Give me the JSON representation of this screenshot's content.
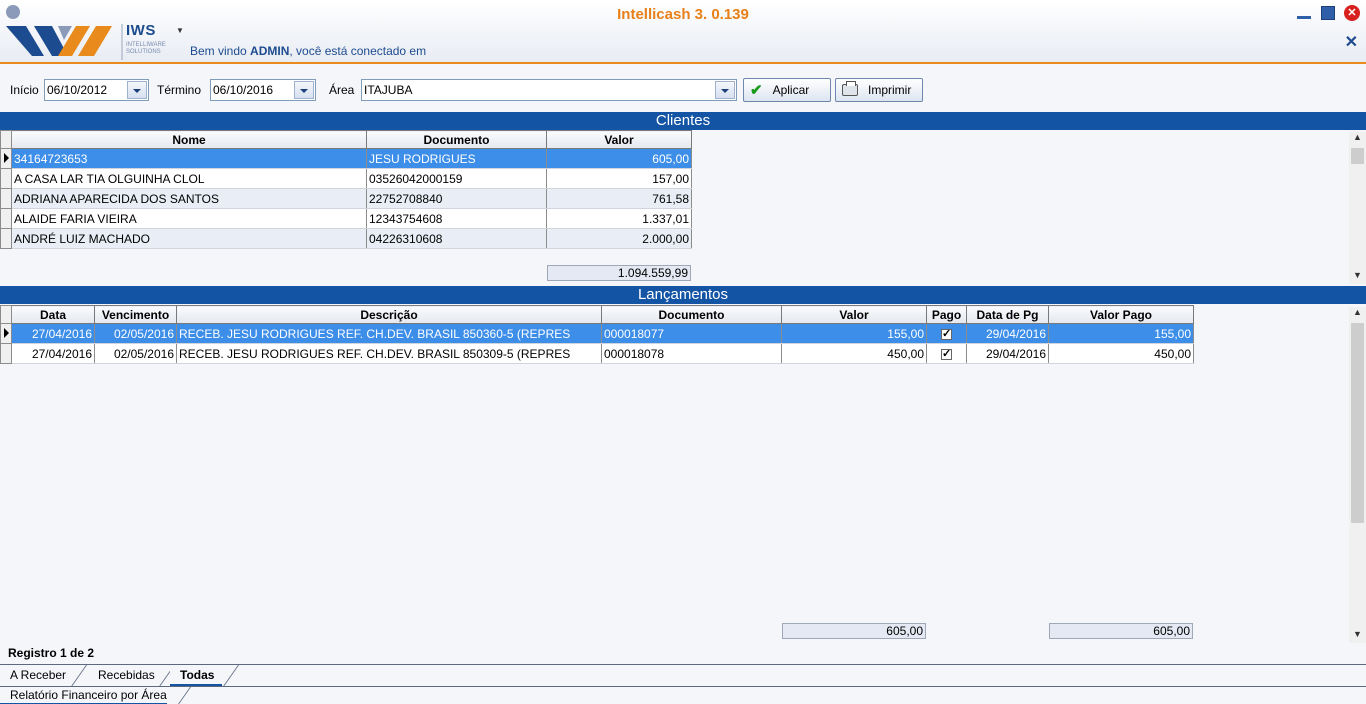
{
  "header": {
    "app_title": "Intellicash 3. 0.139",
    "logo_text": "IWS",
    "logo_subtext": "INTELLIWARE SOLUTIONS",
    "welcome_prefix": "Bem vindo ",
    "welcome_user": "ADMIN",
    "welcome_suffix": ", você está conectado em"
  },
  "filters": {
    "inicio_label": "Início",
    "inicio_value": "06/10/2012",
    "termino_label": "Término",
    "termino_value": "06/10/2016",
    "area_label": "Área",
    "area_value": "ITAJUBA",
    "aplicar_label": "Aplicar",
    "imprimir_label": "Imprimir"
  },
  "clientes": {
    "title": "Clientes",
    "columns": [
      "Nome",
      "Documento",
      "Valor"
    ],
    "rows": [
      {
        "nome": "34164723653",
        "documento": "JESU RODRIGUES",
        "valor": "605,00"
      },
      {
        "nome": "A CASA LAR TIA OLGUINHA CLOL",
        "documento": "03526042000159",
        "valor": "157,00"
      },
      {
        "nome": "ADRIANA APARECIDA DOS SANTOS",
        "documento": "22752708840",
        "valor": "761,58"
      },
      {
        "nome": "ALAIDE FARIA VIEIRA",
        "documento": "12343754608",
        "valor": "1.337,01"
      },
      {
        "nome": "ANDRÉ LUIZ MACHADO",
        "documento": "04226310608",
        "valor": "2.000,00"
      }
    ],
    "total": "1.094.559,99"
  },
  "lancamentos": {
    "title": "Lançamentos",
    "columns": [
      "Data",
      "Vencimento",
      "Descrição",
      "Documento",
      "Valor",
      "Pago",
      "Data de Pg",
      "Valor Pago"
    ],
    "rows": [
      {
        "data": "27/04/2016",
        "vencimento": "02/05/2016",
        "descricao": "RECEB. JESU RODRIGUES REF. CH.DEV. BRASIL 850360-5 (REPRES",
        "documento": "000018077",
        "valor": "155,00",
        "pago": true,
        "data_pg": "29/04/2016",
        "valor_pago": "155,00"
      },
      {
        "data": "27/04/2016",
        "vencimento": "02/05/2016",
        "descricao": "RECEB. JESU RODRIGUES REF. CH.DEV. BRASIL 850309-5 (REPRES",
        "documento": "000018078",
        "valor": "450,00",
        "pago": true,
        "data_pg": "29/04/2016",
        "valor_pago": "450,00"
      }
    ],
    "total_valor": "605,00",
    "total_valor_pago": "605,00"
  },
  "status": {
    "registro": "Registro 1 de 2"
  },
  "tabs": {
    "items": [
      "A Receber",
      "Recebidas",
      "Todas"
    ],
    "active": "Todas"
  },
  "footer_tab": "Relatório Financeiro por Área",
  "colors": {
    "accent_blue": "#1454a4",
    "title_orange": "#e8801a",
    "selection": "#3d8ee8"
  }
}
